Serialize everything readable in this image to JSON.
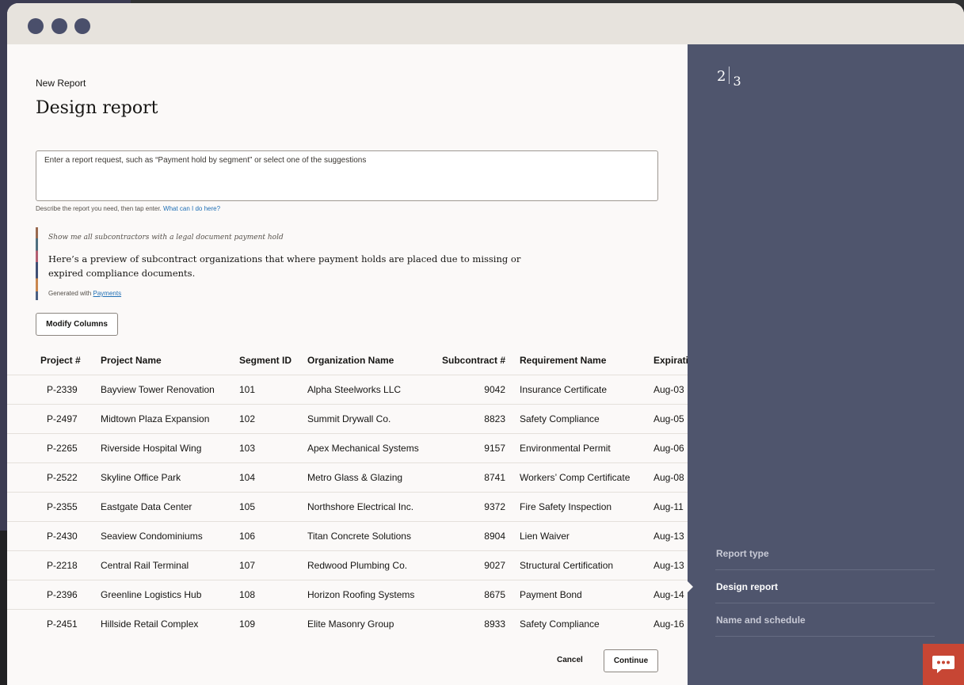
{
  "page": {
    "breadcrumb": "New Report",
    "title": "Design report"
  },
  "request": {
    "placeholder": "Enter a report request, such as “Payment hold by segment” or select one of the suggestions",
    "help_text": "Describe the report you need, then tap enter.",
    "help_link": "What can I do here?"
  },
  "ai_response": {
    "query": "Show me all subcontractors with a legal document payment hold",
    "answer": "Here’s a preview of subcontract organizations that where payment holds are placed due to missing or expired compliance documents.",
    "generated_prefix": "Generated with",
    "generated_link": "Payments"
  },
  "actions": {
    "modify_columns": "Modify Columns",
    "cancel": "Cancel",
    "continue": "Continue"
  },
  "table": {
    "columns": [
      "Project #",
      "Project Name",
      "Segment ID",
      "Organization Name",
      "Subcontract #",
      "Requirement Name",
      "Expiration"
    ],
    "rows": [
      [
        "P-2339",
        "Bayview Tower Renovation",
        "101",
        "Alpha Steelworks LLC",
        "9042",
        "Insurance Certificate",
        "Aug-03"
      ],
      [
        "P-2497",
        "Midtown Plaza Expansion",
        "102",
        "Summit Drywall Co.",
        "8823",
        "Safety Compliance",
        "Aug-05"
      ],
      [
        "P-2265",
        "Riverside Hospital Wing",
        "103",
        "Apex Mechanical Systems",
        "9157",
        "Environmental Permit",
        "Aug-06"
      ],
      [
        "P-2522",
        "Skyline Office Park",
        "104",
        "Metro Glass & Glazing",
        "8741",
        "Workers’ Comp Certificate",
        "Aug-08"
      ],
      [
        "P-2355",
        "Eastgate Data Center",
        "105",
        "Northshore Electrical Inc.",
        "9372",
        "Fire Safety Inspection",
        "Aug-11"
      ],
      [
        "P-2430",
        "Seaview Condominiums",
        "106",
        "Titan Concrete Solutions",
        "8904",
        "Lien Waiver",
        "Aug-13"
      ],
      [
        "P-2218",
        "Central Rail Terminal",
        "107",
        "Redwood Plumbing Co.",
        "9027",
        "Structural Certification",
        "Aug-13"
      ],
      [
        "P-2396",
        "Greenline Logistics Hub",
        "108",
        "Horizon Roofing Systems",
        "8675",
        "Payment Bond",
        "Aug-14"
      ],
      [
        "P-2451",
        "Hillside Retail Complex",
        "109",
        "Elite Masonry Group",
        "8933",
        "Safety Compliance",
        "Aug-16"
      ]
    ]
  },
  "progress": {
    "current": "2",
    "total": "3",
    "steps": [
      "Report type",
      "Design report",
      "Name and schedule"
    ],
    "current_step_index": 1
  },
  "icons": {
    "chat": "chat-bubble-icon",
    "current_step": "triangle-marker-icon"
  },
  "colors": {
    "side_panel": "#4f556d",
    "chat_button": "#c74634",
    "link": "#1f6fb5"
  }
}
